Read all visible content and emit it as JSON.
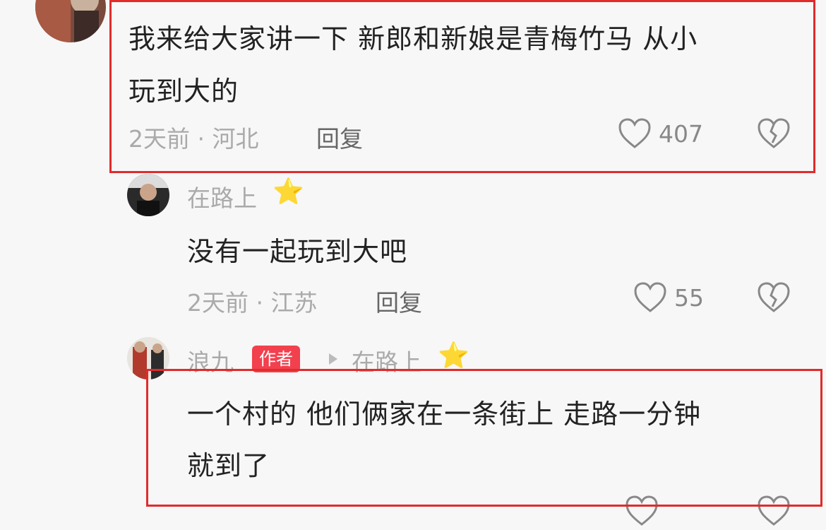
{
  "comments": [
    {
      "text_line1": "我来给大家讲一下 新郎和新娘是青梅竹马 从小",
      "text_line2": "玩到大的",
      "meta": "2天前 · 河北",
      "reply_label": "回复",
      "likes": "407"
    },
    {
      "username": "在路上",
      "username_emoji": "⭐",
      "text": "没有一起玩到大吧",
      "meta": "2天前 · 江苏",
      "reply_label": "回复",
      "likes": "55"
    },
    {
      "username": "浪九",
      "badge": "作者",
      "reply_to": "在路上",
      "reply_to_emoji": "⭐",
      "text_line1": "一个村的 他们俩家在一条街上 走路一分钟",
      "text_line2": "就到了"
    }
  ],
  "colors": {
    "highlight_box": "#e12b2b",
    "author_badge": "#f2404e"
  },
  "icons": [
    "heart-icon",
    "broken-heart-icon",
    "star-emoji",
    "triangle-arrow-icon"
  ]
}
